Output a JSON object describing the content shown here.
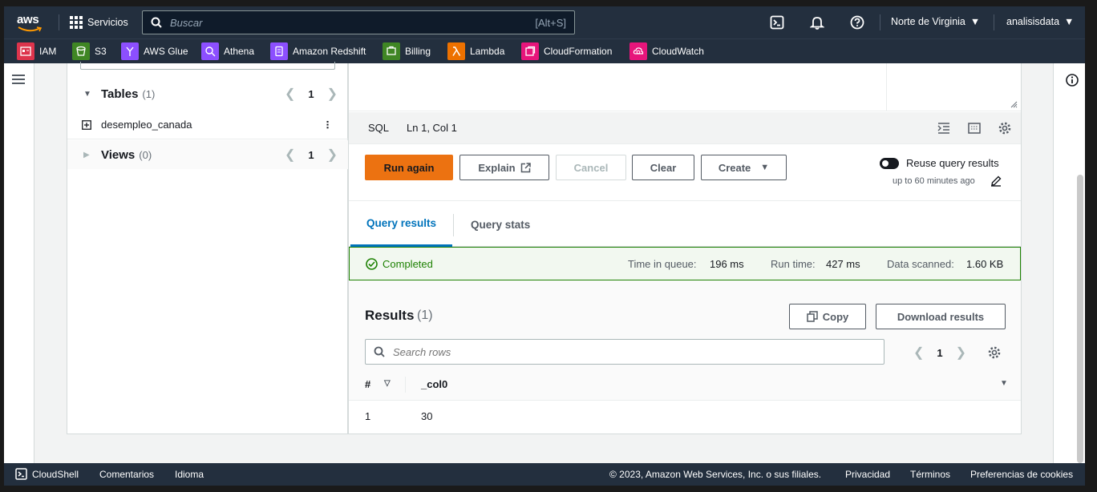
{
  "header": {
    "logo": "aws",
    "services_label": "Servicios",
    "search_placeholder": "Buscar",
    "search_shortcut": "[Alt+S]",
    "region": "Norte de Virginia",
    "account": "analisisdata"
  },
  "favorites": [
    {
      "label": "IAM",
      "color": "#dd344c"
    },
    {
      "label": "S3",
      "color": "#3f8624"
    },
    {
      "label": "AWS Glue",
      "color": "#8c4fff"
    },
    {
      "label": "Athena",
      "color": "#8c4fff"
    },
    {
      "label": "Amazon Redshift",
      "color": "#8c4fff"
    },
    {
      "label": "Billing",
      "color": "#3f8624"
    },
    {
      "label": "Lambda",
      "color": "#ed7100"
    },
    {
      "label": "CloudFormation",
      "color": "#e7157b"
    },
    {
      "label": "CloudWatch",
      "color": "#e7157b"
    }
  ],
  "sidebar": {
    "tables_label": "Tables",
    "tables_count": "(1)",
    "tables_page": "1",
    "table_item": "desempleo_canada",
    "views_label": "Views",
    "views_count": "(0)",
    "views_page": "1"
  },
  "editor": {
    "language": "SQL",
    "position": "Ln 1, Col 1"
  },
  "actions": {
    "run": "Run again",
    "explain": "Explain",
    "cancel": "Cancel",
    "clear": "Clear",
    "create": "Create",
    "reuse_label": "Reuse query results",
    "reuse_sub": "up to 60 minutes ago"
  },
  "tabs": [
    "Query results",
    "Query stats"
  ],
  "status": {
    "state": "Completed",
    "queue_label": "Time in queue:",
    "queue_value": "196 ms",
    "run_label": "Run time:",
    "run_value": "427 ms",
    "scanned_label": "Data scanned:",
    "scanned_value": "1.60 KB"
  },
  "results": {
    "title": "Results",
    "count": "(1)",
    "copy": "Copy",
    "download": "Download results",
    "search_placeholder": "Search rows",
    "page": "1",
    "columns": [
      "#",
      "_col0"
    ],
    "rows": [
      [
        "1",
        "30"
      ]
    ]
  },
  "footer": {
    "cloudshell": "CloudShell",
    "feedback": "Comentarios",
    "language": "Idioma",
    "copyright": "© 2023, Amazon Web Services, Inc. o sus filiales.",
    "privacy": "Privacidad",
    "terms": "Términos",
    "cookies": "Preferencias de cookies"
  },
  "colors": {
    "nav": "#232f3e",
    "primary": "#ec7211",
    "link": "#0073bb",
    "success": "#1d8102"
  }
}
